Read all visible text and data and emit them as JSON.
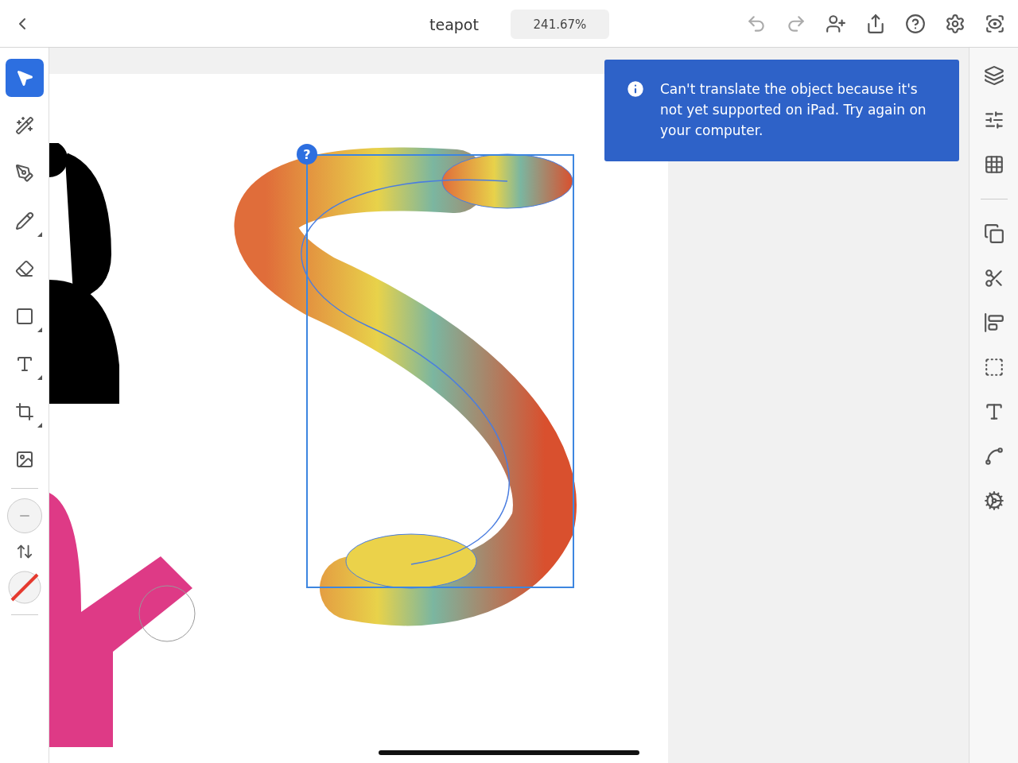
{
  "top_bar": {
    "title": "teapot",
    "zoom": "241.67%",
    "actions": [
      {
        "kind": "undo",
        "disabled": true
      },
      {
        "kind": "redo",
        "disabled": true
      },
      {
        "kind": "invite",
        "disabled": false
      },
      {
        "kind": "share",
        "disabled": false
      },
      {
        "kind": "help",
        "disabled": false
      },
      {
        "kind": "settings",
        "disabled": false
      },
      {
        "kind": "preview",
        "disabled": false
      }
    ]
  },
  "tools": [
    {
      "kind": "select",
      "selected": true,
      "flyout": false
    },
    {
      "kind": "direct",
      "selected": false,
      "flyout": false
    },
    {
      "kind": "pen",
      "selected": false,
      "flyout": false
    },
    {
      "kind": "pencil",
      "selected": false,
      "flyout": true
    },
    {
      "kind": "eraser",
      "selected": false,
      "flyout": false
    },
    {
      "kind": "shape",
      "selected": false,
      "flyout": true
    },
    {
      "kind": "type",
      "selected": false,
      "flyout": true
    },
    {
      "kind": "crop",
      "selected": false,
      "flyout": true
    },
    {
      "kind": "image",
      "selected": false,
      "flyout": false
    }
  ],
  "panels": [
    {
      "kind": "layers"
    },
    {
      "kind": "properties"
    },
    {
      "kind": "grid"
    },
    {
      "kind": "divider"
    },
    {
      "kind": "combine"
    },
    {
      "kind": "cut"
    },
    {
      "kind": "align"
    },
    {
      "kind": "transform"
    },
    {
      "kind": "type"
    },
    {
      "kind": "path"
    },
    {
      "kind": "repeat"
    }
  ],
  "canvas": {
    "selection_badge": "?",
    "toast": "Can't translate the object because it's not yet supported on iPad. Try again on your computer."
  }
}
